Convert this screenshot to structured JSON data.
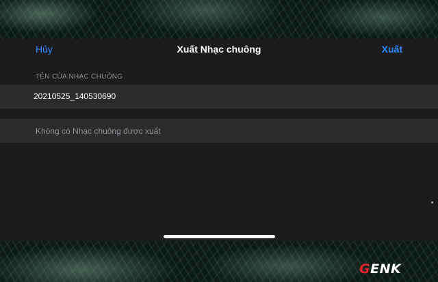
{
  "navbar": {
    "cancel_label": "Hủy",
    "title": "Xuất Nhạc chuông",
    "export_label": "Xuất"
  },
  "section": {
    "header": "TÊN CỦA NHẠC CHUÔNG"
  },
  "ringtone_name": {
    "value": "20210525_140530690"
  },
  "exported": {
    "empty_text": "Không có Nhạc chuông được xuất"
  },
  "watermark": {
    "logo_first": "G",
    "logo_rest": "ENK"
  },
  "colors": {
    "accent": "#2e8bff",
    "sheet_bg": "#1c1c1e",
    "cell_bg": "#2c2c2e",
    "secondary_text": "#8e8e93",
    "logo_red": "#e4242b"
  }
}
